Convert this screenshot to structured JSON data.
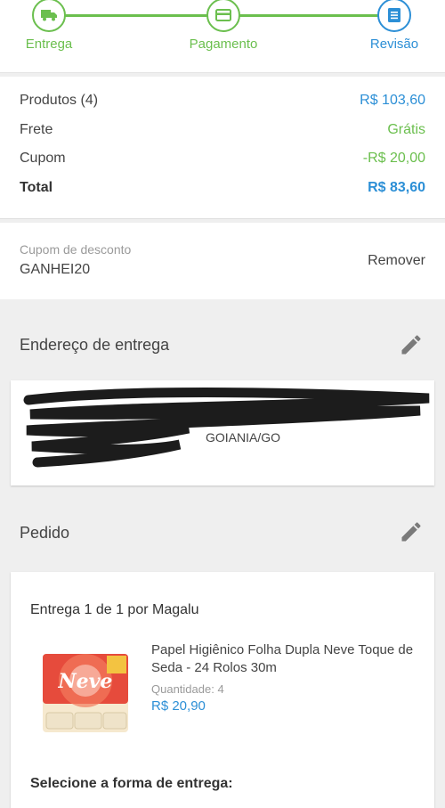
{
  "stepper": {
    "steps": [
      {
        "label": "Entrega",
        "icon": "truck-icon"
      },
      {
        "label": "Pagamento",
        "icon": "card-icon"
      },
      {
        "label": "Revisão",
        "icon": "list-icon"
      }
    ],
    "active_index": 2,
    "done_color": "#6bbf4e",
    "active_color": "#2c8fd6"
  },
  "summary": {
    "products_label": "Produtos (4)",
    "products_value": "R$ 103,60",
    "shipping_label": "Frete",
    "shipping_value": "Grátis",
    "coupon_label": "Cupom",
    "coupon_value": "-R$ 20,00",
    "total_label": "Total",
    "total_value": "R$ 83,60"
  },
  "coupon": {
    "label": "Cupom de desconto",
    "code": "GANHEI20",
    "remove_label": "Remover"
  },
  "address": {
    "title": "Endereço de entrega",
    "city": "GOIANIA/GO"
  },
  "order": {
    "title": "Pedido",
    "delivery_title": "Entrega 1 de 1 por Magalu",
    "product": {
      "name": "Papel Higiênico Folha Dupla Neve Toque de Seda - 24 Rolos 30m",
      "quantity_label": "Quantidade:",
      "quantity_value": "4",
      "price": "R$ 20,90",
      "image_brand": "Neve"
    },
    "select_shipping_label": "Selecione a forma de entrega:"
  }
}
